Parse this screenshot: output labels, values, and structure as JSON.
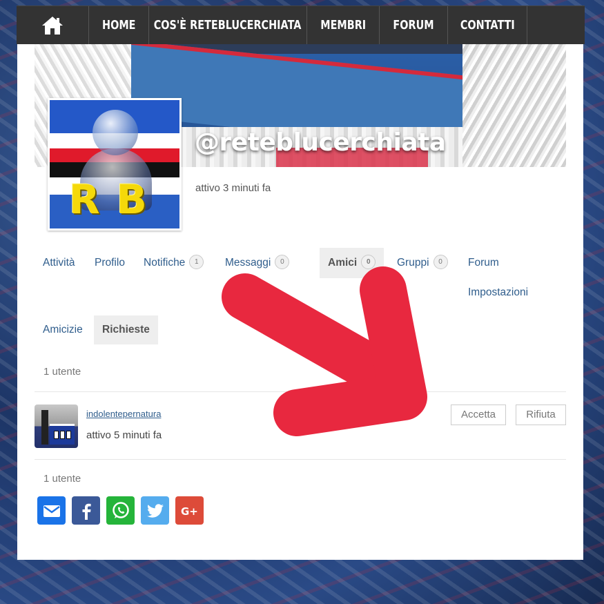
{
  "nav": {
    "home_icon": "home-icon",
    "items": [
      {
        "label": "HOME"
      },
      {
        "label": "COS'È RETEBLUCERCHIATA"
      },
      {
        "label": "MEMBRI"
      },
      {
        "label": "FORUM"
      },
      {
        "label": "CONTATTI"
      }
    ]
  },
  "profile": {
    "username": "@reteblucerchiata",
    "status": "attivo 3 minuti fa",
    "avatar_letters": "RB"
  },
  "tabs": [
    {
      "label": "Attività",
      "count": null
    },
    {
      "label": "Profilo",
      "count": null
    },
    {
      "label": "Notifiche",
      "count": "1"
    },
    {
      "label": "Messaggi",
      "count": "0"
    },
    {
      "label": "Amici",
      "count": "0",
      "active": true
    },
    {
      "label": "Gruppi",
      "count": "0"
    },
    {
      "label": "Forum",
      "count": null
    },
    {
      "label": "Impostazioni",
      "count": null
    }
  ],
  "subtabs": [
    {
      "label": "Amicizie"
    },
    {
      "label": "Richieste",
      "active": true
    }
  ],
  "requests": {
    "count_top": "1 utente",
    "count_bottom": "1 utente",
    "items": [
      {
        "name": "indolentepernatura",
        "status": "attivo 5 minuti fa",
        "accept_label": "Accetta",
        "reject_label": "Rifiuta"
      }
    ]
  },
  "share": [
    {
      "icon": "email-icon",
      "color": "#1a73e8"
    },
    {
      "icon": "facebook-icon",
      "color": "#3b5998"
    },
    {
      "icon": "whatsapp-icon",
      "color": "#25b43a"
    },
    {
      "icon": "twitter-icon",
      "color": "#55acee"
    },
    {
      "icon": "google-plus-icon",
      "color": "#dd4b39"
    }
  ],
  "colors": {
    "nav_bg": "#333333",
    "link": "#2f5d8c",
    "arrow": "#e8283f"
  }
}
